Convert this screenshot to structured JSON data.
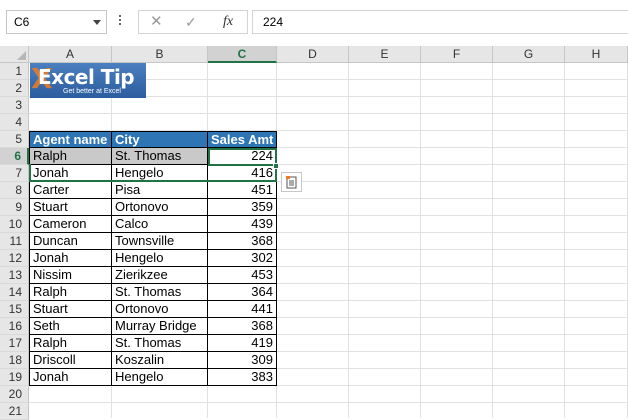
{
  "formula_bar": {
    "name_box": "C6",
    "cancel_icon": "✕",
    "enter_icon": "✓",
    "fx_label": "fx",
    "formula_value": "224"
  },
  "columns": [
    "A",
    "B",
    "C",
    "D",
    "E",
    "F",
    "G",
    "H"
  ],
  "rows": [
    "1",
    "2",
    "3",
    "4",
    "5",
    "6",
    "7",
    "8",
    "9",
    "10",
    "11",
    "12",
    "13",
    "14",
    "15",
    "16",
    "17",
    "18",
    "19",
    "20",
    "21"
  ],
  "selected_cell": "C6",
  "logo": {
    "brand": "Excel Tip",
    "word": "Excel Tip",
    "tagline": "Get better at Excel",
    "accent_color": "#f07b22"
  },
  "table": {
    "headers": [
      "Agent name",
      "City",
      "Sales Amt"
    ],
    "header_color": "#2e75b6",
    "rows": [
      [
        "Ralph",
        "St. Thomas",
        "224"
      ],
      [
        "Jonah",
        "Hengelo",
        "416"
      ],
      [
        "Carter",
        "Pisa",
        "451"
      ],
      [
        "Stuart",
        "Ortonovo",
        "359"
      ],
      [
        "Cameron",
        "Calco",
        "439"
      ],
      [
        "Duncan",
        "Townsville",
        "368"
      ],
      [
        "Jonah",
        "Hengelo",
        "302"
      ],
      [
        "Nissim",
        "Zierikzee",
        "453"
      ],
      [
        "Ralph",
        "St. Thomas",
        "364"
      ],
      [
        "Stuart",
        "Ortonovo",
        "441"
      ],
      [
        "Seth",
        "Murray Bridge",
        "368"
      ],
      [
        "Ralph",
        "St. Thomas",
        "419"
      ],
      [
        "Driscoll",
        "Koszalin",
        "309"
      ],
      [
        "Jonah",
        "Hengelo",
        "383"
      ]
    ]
  },
  "quick_analysis_icon": "quick-analysis-icon"
}
